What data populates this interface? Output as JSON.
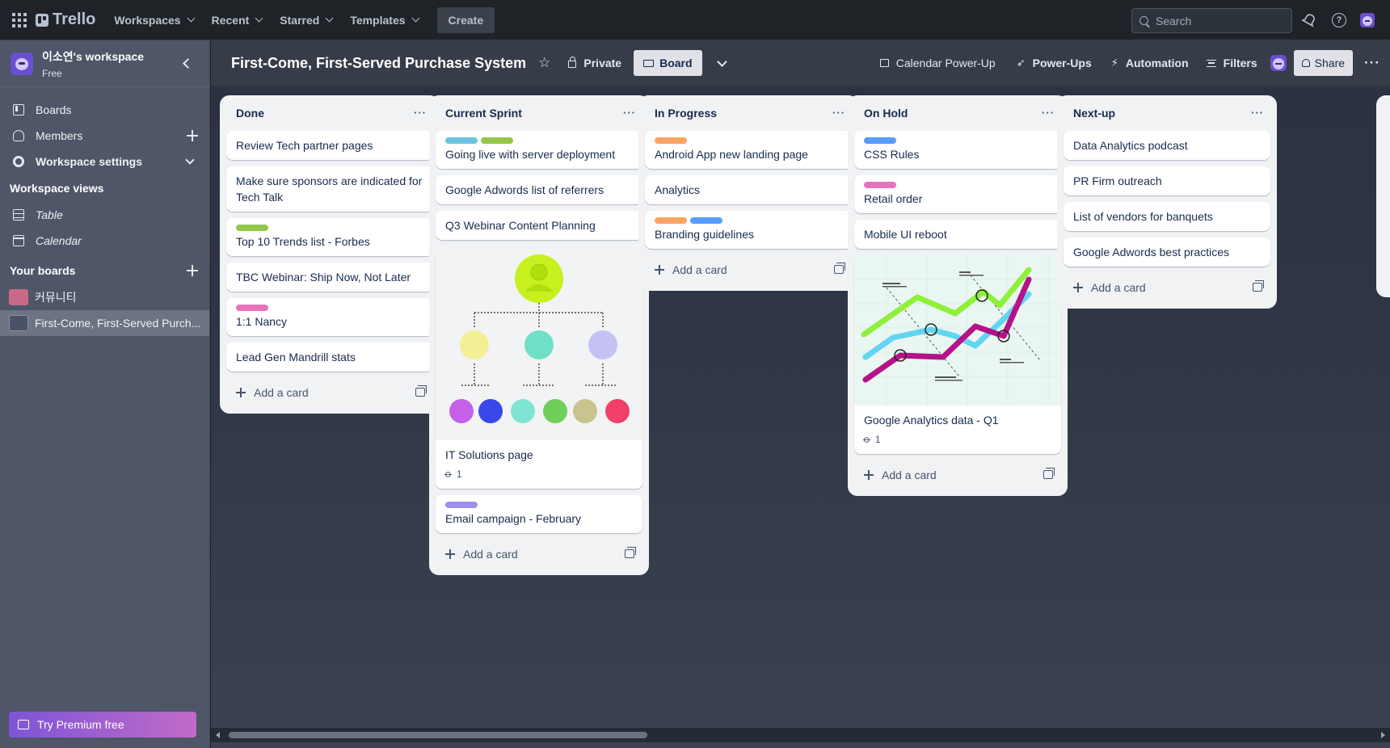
{
  "topbar": {
    "app_name": "Trello",
    "nav": [
      "Workspaces",
      "Recent",
      "Starred",
      "Templates"
    ],
    "create_label": "Create",
    "search_placeholder": "Search"
  },
  "sidebar": {
    "workspace_name": "이소연's workspace",
    "workspace_plan": "Free",
    "items": [
      {
        "label": "Boards",
        "icon": "board-icon"
      },
      {
        "label": "Members",
        "icon": "member-icon"
      },
      {
        "label": "Workspace settings",
        "icon": "gear-icon"
      }
    ],
    "views_heading": "Workspace views",
    "views": [
      {
        "label": "Table",
        "icon": "table-icon"
      },
      {
        "label": "Calendar",
        "icon": "calendar-icon"
      }
    ],
    "boards_heading": "Your boards",
    "boards": [
      {
        "label": "커뮤니티",
        "color": "#c86a87"
      },
      {
        "label": "First-Come, First-Served Purch...",
        "color": "#4a5268"
      }
    ],
    "premium_label": "Try Premium free"
  },
  "board_header": {
    "title": "First-Come, First-Served Purchase System",
    "visibility": "Private",
    "view": "Board",
    "calendar_label": "Calendar Power-Up",
    "powerups_label": "Power-Ups",
    "automation_label": "Automation",
    "filters_label": "Filters",
    "share_label": "Share"
  },
  "add_card_label": "Add a card",
  "lists": [
    {
      "title": "Done",
      "cards": [
        {
          "title": "Review Tech partner pages",
          "labels": []
        },
        {
          "title": "Make sure sponsors are indicated for Tech Talk",
          "labels": []
        },
        {
          "title": "Top 10 Trends list - Forbes",
          "labels": [
            "#94c748"
          ]
        },
        {
          "title": "TBC Webinar: Ship Now, Not Later",
          "labels": []
        },
        {
          "title": "1:1 Nancy",
          "labels": [
            "#e774bb"
          ]
        },
        {
          "title": "Lead Gen Mandrill stats",
          "labels": []
        }
      ]
    },
    {
      "title": "Current Sprint",
      "cards": [
        {
          "title": "Going live with server deployment",
          "labels": [
            "#6cc3e0",
            "#94c748"
          ]
        },
        {
          "title": "Google Adwords list of referrers",
          "labels": []
        },
        {
          "title": "Q3 Webinar Content Planning",
          "labels": []
        },
        {
          "title": "IT Solutions page",
          "labels": [],
          "cover": "org-chart",
          "attachments": "1"
        },
        {
          "title": "Email campaign - February",
          "labels": [
            "#9f8fef"
          ]
        }
      ]
    },
    {
      "title": "In Progress",
      "cards": [
        {
          "title": "Android App new landing page",
          "labels": [
            "#fea362"
          ]
        },
        {
          "title": "Analytics",
          "labels": []
        },
        {
          "title": "Branding guidelines",
          "labels": [
            "#fea362",
            "#579dff"
          ]
        }
      ]
    },
    {
      "title": "On Hold",
      "cards": [
        {
          "title": "CSS Rules",
          "labels": [
            "#579dff"
          ]
        },
        {
          "title": "Retail order",
          "labels": [
            "#e774bb"
          ]
        },
        {
          "title": "Mobile UI reboot",
          "labels": []
        },
        {
          "title": "Google Analytics data - Q1",
          "labels": [],
          "cover": "line-chart",
          "attachments": "1"
        }
      ]
    },
    {
      "title": "Next-up",
      "cards": [
        {
          "title": "Data Analytics podcast",
          "labels": []
        },
        {
          "title": "PR Firm outreach",
          "labels": []
        },
        {
          "title": "List of vendors for banquets",
          "labels": []
        },
        {
          "title": "Google Adwords best practices",
          "labels": []
        }
      ]
    }
  ]
}
